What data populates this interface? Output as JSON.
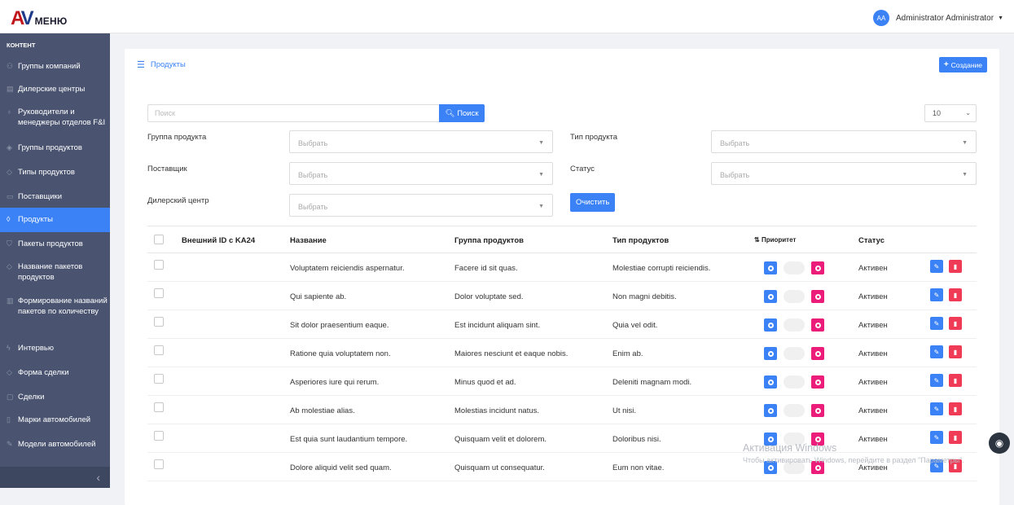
{
  "app": {
    "logo_text": "МЕНЮ",
    "logo_mark_a": "A",
    "logo_mark_v": "V"
  },
  "user": {
    "initials": "AA",
    "name": "Administrator Administrator"
  },
  "sidebar": {
    "heading": "КОНТЕНТ",
    "items": [
      {
        "label": "Группы компаний",
        "icon": "users-icon"
      },
      {
        "label": "Дилерские центры",
        "icon": "building-icon"
      },
      {
        "label": "Руководители и менеджеры отделов F&I",
        "icon": "person-icon"
      },
      {
        "label": "Группы продуктов",
        "icon": "layers-icon"
      },
      {
        "label": "Типы продуктов",
        "icon": "tag-icon"
      },
      {
        "label": "Поставщики",
        "icon": "briefcase-icon"
      },
      {
        "label": "Продукты",
        "icon": "drop-icon",
        "active": true
      },
      {
        "label": "Пакеты продуктов",
        "icon": "cart-icon"
      },
      {
        "label": "Название пакетов продуктов",
        "icon": "tag-icon"
      },
      {
        "label": "Формирование названий пакетов по количеству",
        "icon": "chart-icon"
      },
      {
        "label": "Интервью",
        "icon": "lightning-icon"
      },
      {
        "label": "Форма сделки",
        "icon": "tag-icon"
      },
      {
        "label": "Сделки",
        "icon": "folder-icon"
      },
      {
        "label": "Марки автомобилей",
        "icon": "document-icon"
      },
      {
        "label": "Модели автомобилей",
        "icon": "pencil-icon"
      }
    ],
    "collapse_glyph": "‹"
  },
  "page": {
    "breadcrumb": "Продукты",
    "create_label": "Создание"
  },
  "search": {
    "placeholder": "Поиск",
    "button_label": "Поиск"
  },
  "per_page": {
    "value": "10"
  },
  "filters": {
    "product_group_label": "Группа продукта",
    "product_type_label": "Тип продукта",
    "supplier_label": "Поставщик",
    "status_label": "Статус",
    "dealer_label": "Дилерский центр",
    "select_placeholder": "Выбрать",
    "clear_label": "Очистить"
  },
  "table": {
    "columns": {
      "external_id": "Внешний ID с KA24",
      "name": "Название",
      "group": "Группа продуктов",
      "type": "Тип продуктов",
      "priority": "Приоритет",
      "status": "Статус"
    },
    "rows": [
      {
        "name": "Voluptatem reiciendis aspernatur.",
        "group": "Facere id sit quas.",
        "type": "Molestiae corrupti reiciendis.",
        "status": "Активен"
      },
      {
        "name": "Qui sapiente ab.",
        "group": "Dolor voluptate sed.",
        "type": "Non magni debitis.",
        "status": "Активен"
      },
      {
        "name": "Sit dolor praesentium eaque.",
        "group": "Est incidunt aliquam sint.",
        "type": "Quia vel odit.",
        "status": "Активен"
      },
      {
        "name": "Ratione quia voluptatem non.",
        "group": "Maiores nesciunt et eaque nobis.",
        "type": "Enim ab.",
        "status": "Активен"
      },
      {
        "name": "Asperiores iure qui rerum.",
        "group": "Minus quod et ad.",
        "type": "Deleniti magnam modi.",
        "status": "Активен"
      },
      {
        "name": "Ab molestiae alias.",
        "group": "Molestias incidunt natus.",
        "type": "Ut nisi.",
        "status": "Активен"
      },
      {
        "name": "Est quia sunt laudantium tempore.",
        "group": "Quisquam velit et dolorem.",
        "type": "Doloribus nisi.",
        "status": "Активен"
      },
      {
        "name": "Dolore aliquid velit sed quam.",
        "group": "Quisquam ut consequatur.",
        "type": "Eum non vitae.",
        "status": "Активен"
      }
    ]
  },
  "watermark": {
    "title": "Активация Windows",
    "subtitle": "Чтобы активировать Windows, перейдите в раздел \"Параметры\"."
  },
  "colors": {
    "primary": "#3b82f6",
    "sidebar": "#4a5470",
    "pink": "#ec1c7a",
    "danger": "#ef3b56"
  }
}
